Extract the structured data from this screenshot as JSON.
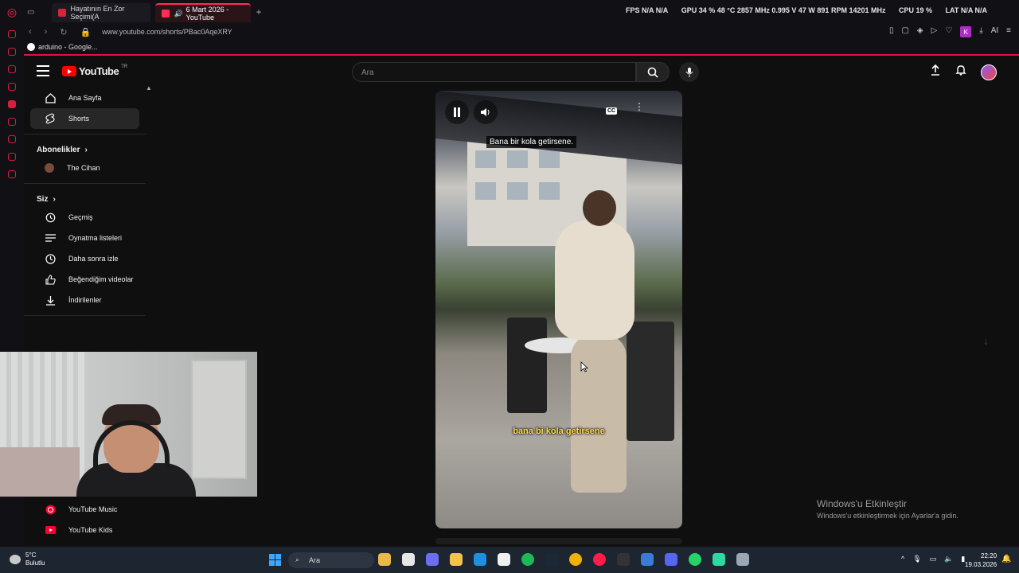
{
  "browser": {
    "tabs": [
      {
        "title": "Hayatının En Zor Seçimi(A",
        "fav_color": "#d6243c"
      },
      {
        "title": "6 Mart 2026 - YouTube",
        "fav_color": "#ff2d55",
        "active": true
      }
    ],
    "url": "www.youtube.com/shorts/PBac0AqeXRY",
    "bookmark": "arduino - Google...",
    "hud": {
      "fps_label": "FPS",
      "fps": "N/A  N/A",
      "gpu_label": "GPU",
      "gpu": "34 %  48 °C  2857 MHz  0.995 V  47 W  891 RPM  14201 MHz",
      "cpu_label": "CPU",
      "cpu": "19 %",
      "lat_label": "LAT",
      "lat": "N/A  N/A"
    },
    "profile_initial": "K",
    "ai_label": "AI"
  },
  "youtube": {
    "logo_text": "YouTube",
    "region": "TR",
    "search_placeholder": "Ara",
    "sidebar": {
      "main": [
        {
          "label": "Ana Sayfa",
          "icon": "home-icon"
        },
        {
          "label": "Shorts",
          "icon": "shorts-icon",
          "active": true
        }
      ],
      "subs_header": "Abonelikler",
      "subs": [
        {
          "label": "The Cihan"
        }
      ],
      "you_header": "Siz",
      "you": [
        {
          "label": "Geçmiş",
          "icon": "history-icon"
        },
        {
          "label": "Oynatma listeleri",
          "icon": "playlist-icon"
        },
        {
          "label": "Daha sonra izle",
          "icon": "clock-icon"
        },
        {
          "label": "Beğendiğim videolar",
          "icon": "thumbs-up-icon"
        },
        {
          "label": "İndirilenler",
          "icon": "download-icon"
        }
      ],
      "more": [
        {
          "label": "YouTube Music",
          "icon": "yt-music-icon"
        },
        {
          "label": "YouTube Kids",
          "icon": "yt-kids-icon"
        }
      ]
    },
    "video": {
      "caption_top": "Bana bir kola getirsene.",
      "caption_bottom": "bana bi kola getirsene",
      "cc_label": "CC"
    }
  },
  "activation": {
    "title": "Windows'u Etkinleştir",
    "subtitle": "Windows'u etkinleştirmek için Ayarlar'a gidin."
  },
  "taskbar": {
    "weather_temp": "5°C",
    "weather_desc": "Bulutlu",
    "search_label": "Ara",
    "time": "22:20",
    "date": "19.03.2026"
  }
}
